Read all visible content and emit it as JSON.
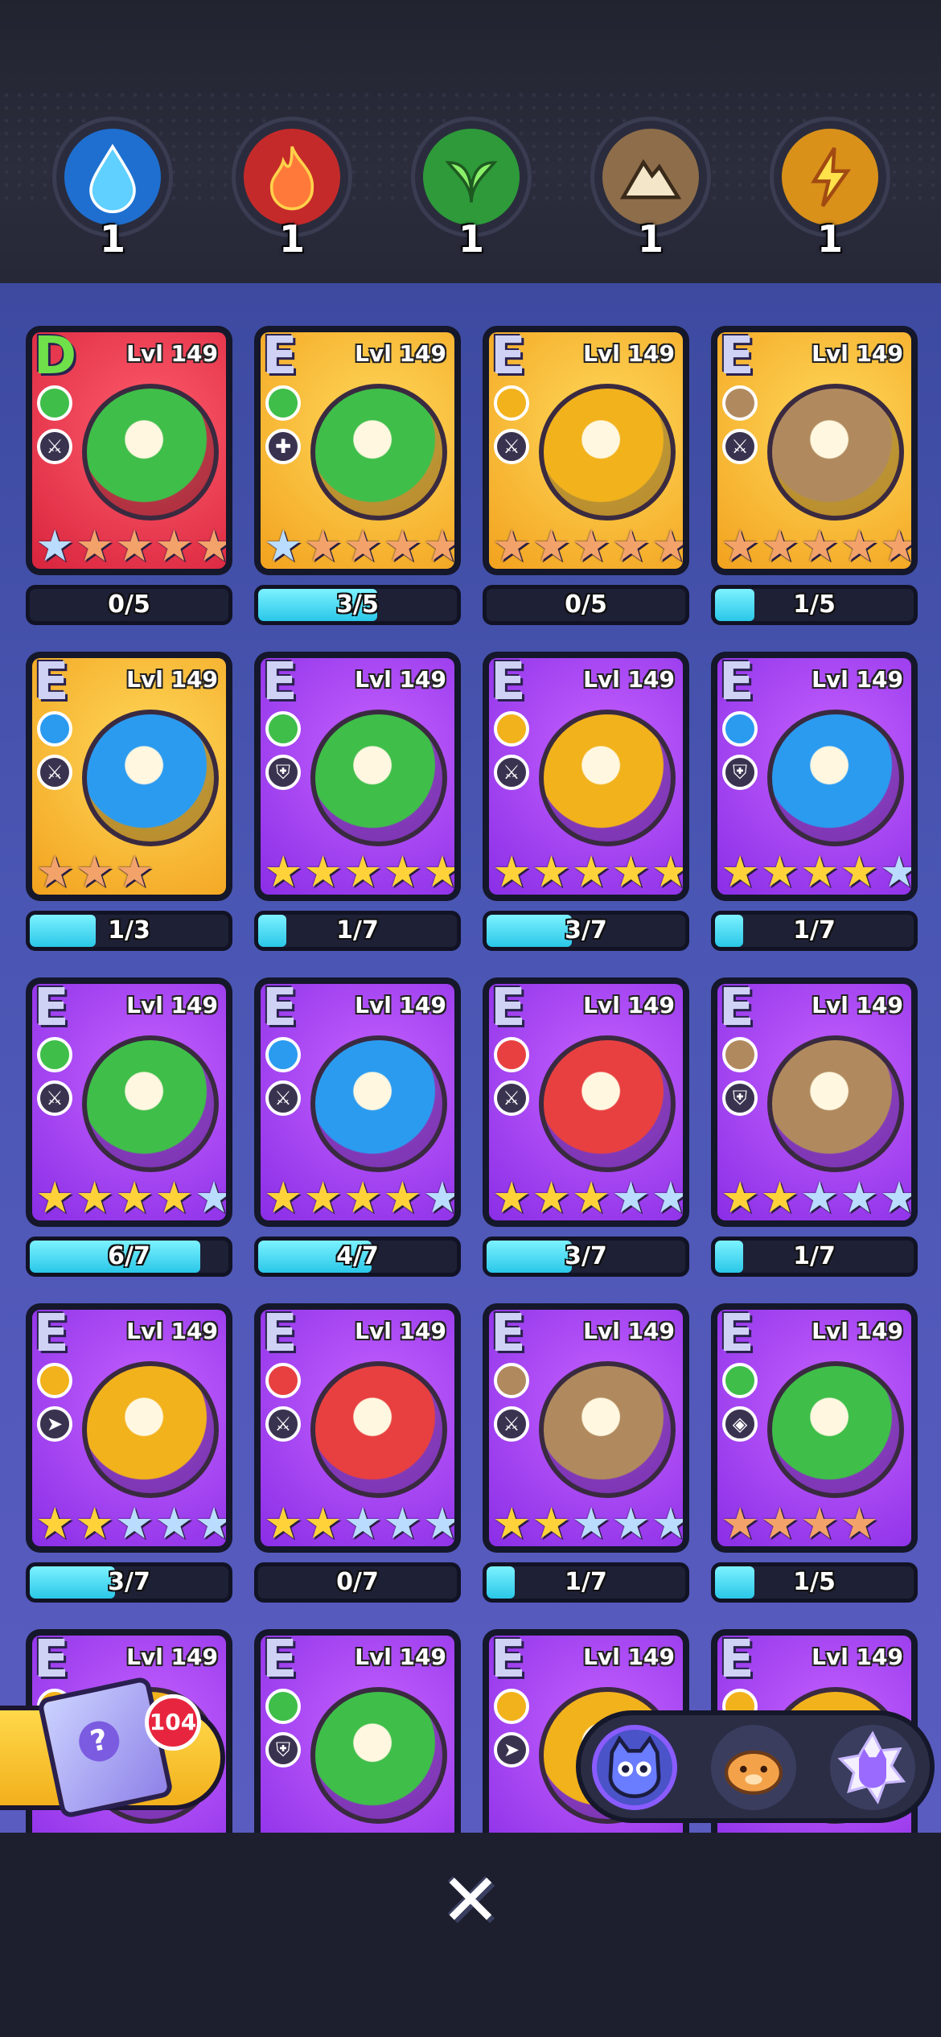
{
  "elements": [
    {
      "name": "water",
      "count": "1",
      "color": "#2b9bf0",
      "icon": "water-drop-icon"
    },
    {
      "name": "fire",
      "count": "1",
      "color": "#e84040",
      "icon": "fire-icon"
    },
    {
      "name": "nature",
      "count": "1",
      "color": "#3fbe4a",
      "icon": "leaf-icon"
    },
    {
      "name": "earth",
      "count": "1",
      "color": "#b08a5e",
      "icon": "mountain-icon"
    },
    {
      "name": "electric",
      "count": "1",
      "color": "#f2b21c",
      "icon": "lightning-icon"
    }
  ],
  "cards": [
    {
      "rank": "D",
      "level": "Lvl 149",
      "bg": "red",
      "type": "nature",
      "role": "attack",
      "stars": [
        "b",
        "o",
        "o",
        "o",
        "o",
        "o"
      ],
      "progress": "0/5",
      "fill": 0.0
    },
    {
      "rank": "E",
      "level": "Lvl 149",
      "bg": "yellow",
      "type": "nature",
      "role": "heal",
      "stars": [
        "b",
        "o",
        "o",
        "o",
        "o",
        "o"
      ],
      "progress": "3/5",
      "fill": 0.6
    },
    {
      "rank": "E",
      "level": "Lvl 149",
      "bg": "yellow",
      "type": "electric",
      "role": "attack",
      "stars": [
        "o",
        "o",
        "o",
        "o",
        "o",
        "o"
      ],
      "progress": "0/5",
      "fill": 0.0
    },
    {
      "rank": "E",
      "level": "Lvl 149",
      "bg": "yellow",
      "type": "earth",
      "role": "attack",
      "stars": [
        "o",
        "o",
        "o",
        "o",
        "o",
        "o"
      ],
      "progress": "1/5",
      "fill": 0.2
    },
    {
      "rank": "E",
      "level": "Lvl 149",
      "bg": "yellow",
      "type": "water",
      "role": "attack",
      "stars": [
        "o",
        "o",
        "o"
      ],
      "progress": "1/3",
      "fill": 0.33
    },
    {
      "rank": "E",
      "level": "Lvl 149",
      "bg": "purple",
      "type": "nature",
      "role": "defense",
      "stars": [
        "g",
        "g",
        "g",
        "g",
        "g",
        "b"
      ],
      "progress": "1/7",
      "fill": 0.143
    },
    {
      "rank": "E",
      "level": "Lvl 149",
      "bg": "purple",
      "type": "electric",
      "role": "attack",
      "stars": [
        "g",
        "g",
        "g",
        "g",
        "g",
        "b"
      ],
      "progress": "3/7",
      "fill": 0.43
    },
    {
      "rank": "E",
      "level": "Lvl 149",
      "bg": "purple",
      "type": "water",
      "role": "defense",
      "stars": [
        "g",
        "g",
        "g",
        "g",
        "b",
        "b"
      ],
      "progress": "1/7",
      "fill": 0.143
    },
    {
      "rank": "E",
      "level": "Lvl 149",
      "bg": "purple",
      "type": "nature",
      "role": "attack",
      "stars": [
        "g",
        "g",
        "g",
        "g",
        "b",
        "b"
      ],
      "progress": "6/7",
      "fill": 0.857
    },
    {
      "rank": "E",
      "level": "Lvl 149",
      "bg": "purple",
      "type": "water",
      "role": "attack",
      "stars": [
        "g",
        "g",
        "g",
        "g",
        "b",
        "b"
      ],
      "progress": "4/7",
      "fill": 0.571
    },
    {
      "rank": "E",
      "level": "Lvl 149",
      "bg": "purple",
      "type": "fire",
      "role": "attack",
      "stars": [
        "g",
        "g",
        "g",
        "b",
        "b",
        "b"
      ],
      "progress": "3/7",
      "fill": 0.43
    },
    {
      "rank": "E",
      "level": "Lvl 149",
      "bg": "purple",
      "type": "earth",
      "role": "defense",
      "stars": [
        "g",
        "g",
        "b",
        "b",
        "b",
        "b"
      ],
      "progress": "1/7",
      "fill": 0.143
    },
    {
      "rank": "E",
      "level": "Lvl 149",
      "bg": "purple",
      "type": "electric",
      "role": "speed",
      "stars": [
        "g",
        "g",
        "b",
        "b",
        "b",
        "b"
      ],
      "progress": "3/7",
      "fill": 0.43
    },
    {
      "rank": "E",
      "level": "Lvl 149",
      "bg": "purple",
      "type": "fire",
      "role": "attack",
      "stars": [
        "g",
        "g",
        "b",
        "b",
        "b",
        "b"
      ],
      "progress": "0/7",
      "fill": 0.0
    },
    {
      "rank": "E",
      "level": "Lvl 149",
      "bg": "purple",
      "type": "earth",
      "role": "attack",
      "stars": [
        "g",
        "g",
        "b",
        "b",
        "b",
        "b"
      ],
      "progress": "1/7",
      "fill": 0.143
    },
    {
      "rank": "E",
      "level": "Lvl 149",
      "bg": "purple",
      "type": "nature",
      "role": "scout",
      "stars": [
        "o",
        "o",
        "o",
        "o"
      ],
      "progress": "1/5",
      "fill": 0.2
    },
    {
      "rank": "E",
      "level": "Lvl 149",
      "bg": "purple",
      "type": "electric",
      "role": "attack",
      "stars": [],
      "progress": "",
      "fill": null
    },
    {
      "rank": "E",
      "level": "Lvl 149",
      "bg": "purple",
      "type": "nature",
      "role": "defense",
      "stars": [],
      "progress": "",
      "fill": null
    },
    {
      "rank": "E",
      "level": "Lvl 149",
      "bg": "purple",
      "type": "electric",
      "role": "speed",
      "stars": [],
      "progress": "",
      "fill": null
    },
    {
      "rank": "E",
      "level": "Lvl 149",
      "bg": "purple",
      "type": "electric",
      "role": "attack",
      "stars": [],
      "progress": "",
      "fill": null
    }
  ],
  "gacha": {
    "count": "104",
    "icon": "mystery-box-icon"
  },
  "filters": [
    {
      "name": "filter-cat",
      "icon": "cat-face-icon",
      "color": "#6a7cff",
      "selected": true
    },
    {
      "name": "filter-hamster",
      "icon": "hamster-face-icon",
      "color": "#f3a24a",
      "selected": false
    },
    {
      "name": "filter-purple-cat",
      "icon": "purple-cat-icon",
      "color": "#b07cff",
      "selected": false
    }
  ],
  "close": {
    "label": "✕",
    "icon": "close-icon"
  },
  "colors": {
    "water": "#2b9bf0",
    "fire": "#e84040",
    "nature": "#3fbe4a",
    "earth": "#b08a5e",
    "electric": "#f2b21c",
    "bar": "#2ac7e8"
  }
}
